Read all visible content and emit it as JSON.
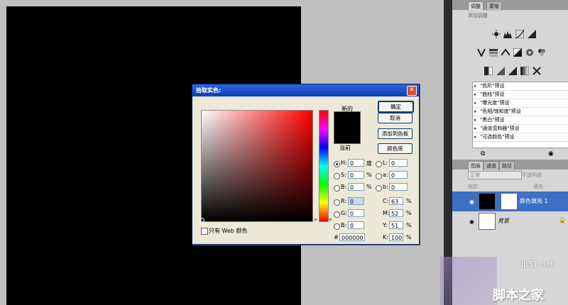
{
  "panel": {
    "tabs": [
      "调整",
      "蒙版"
    ],
    "adjust_title": "添加调整",
    "presets": [
      "\"色阶\"预设",
      "\"曲线\"预设",
      "\"曝光度\"预设",
      "\"色相/饱和度\"预设",
      "\"黑白\"预设",
      "\"通道混和器\"预设",
      "\"可选颜色\"预设"
    ],
    "layer_tabs": [
      "图层",
      "通道",
      "路径"
    ],
    "blend_mode": "正常",
    "opacity_label": "不透明度:",
    "fill_label": "填充:",
    "lock_label": "锁定:",
    "layers": [
      {
        "name": "颜色填充 1"
      },
      {
        "name": "背景"
      }
    ]
  },
  "dialog": {
    "title": "拾取实色:",
    "new_label": "新的",
    "current_label": "当前",
    "buttons": {
      "ok": "确定",
      "cancel": "取消",
      "add_swatch": "添加到色板",
      "color_libraries": "颜色库"
    },
    "hsb": [
      {
        "label": "H:",
        "value": "0",
        "unit": "度"
      },
      {
        "label": "S:",
        "value": "0",
        "unit": "%"
      },
      {
        "label": "B:",
        "value": "0",
        "unit": "%"
      }
    ],
    "rgb": [
      {
        "label": "R:",
        "value": "0"
      },
      {
        "label": "G:",
        "value": "0"
      },
      {
        "label": "B:",
        "value": "0"
      }
    ],
    "lab": [
      {
        "label": "L:",
        "value": "0"
      },
      {
        "label": "a:",
        "value": "0"
      },
      {
        "label": "b:",
        "value": "0"
      }
    ],
    "cmyk": [
      {
        "label": "C:",
        "value": "63",
        "unit": "%"
      },
      {
        "label": "M:",
        "value": "52",
        "unit": "%"
      },
      {
        "label": "Y:",
        "value": "51",
        "unit": "%"
      },
      {
        "label": "K:",
        "value": "100",
        "unit": "%"
      }
    ],
    "hex_label": "#",
    "hex_value": "000000",
    "web_only_label": "只有 Web 颜色"
  },
  "watermark": {
    "site": "jb51.net",
    "name": "脚本之家"
  },
  "colors": {
    "canvas": "#000000",
    "title_bar": "#0a3fb4",
    "panel_bg": "#d6d6d6",
    "workspace": "#c0c0c0"
  }
}
